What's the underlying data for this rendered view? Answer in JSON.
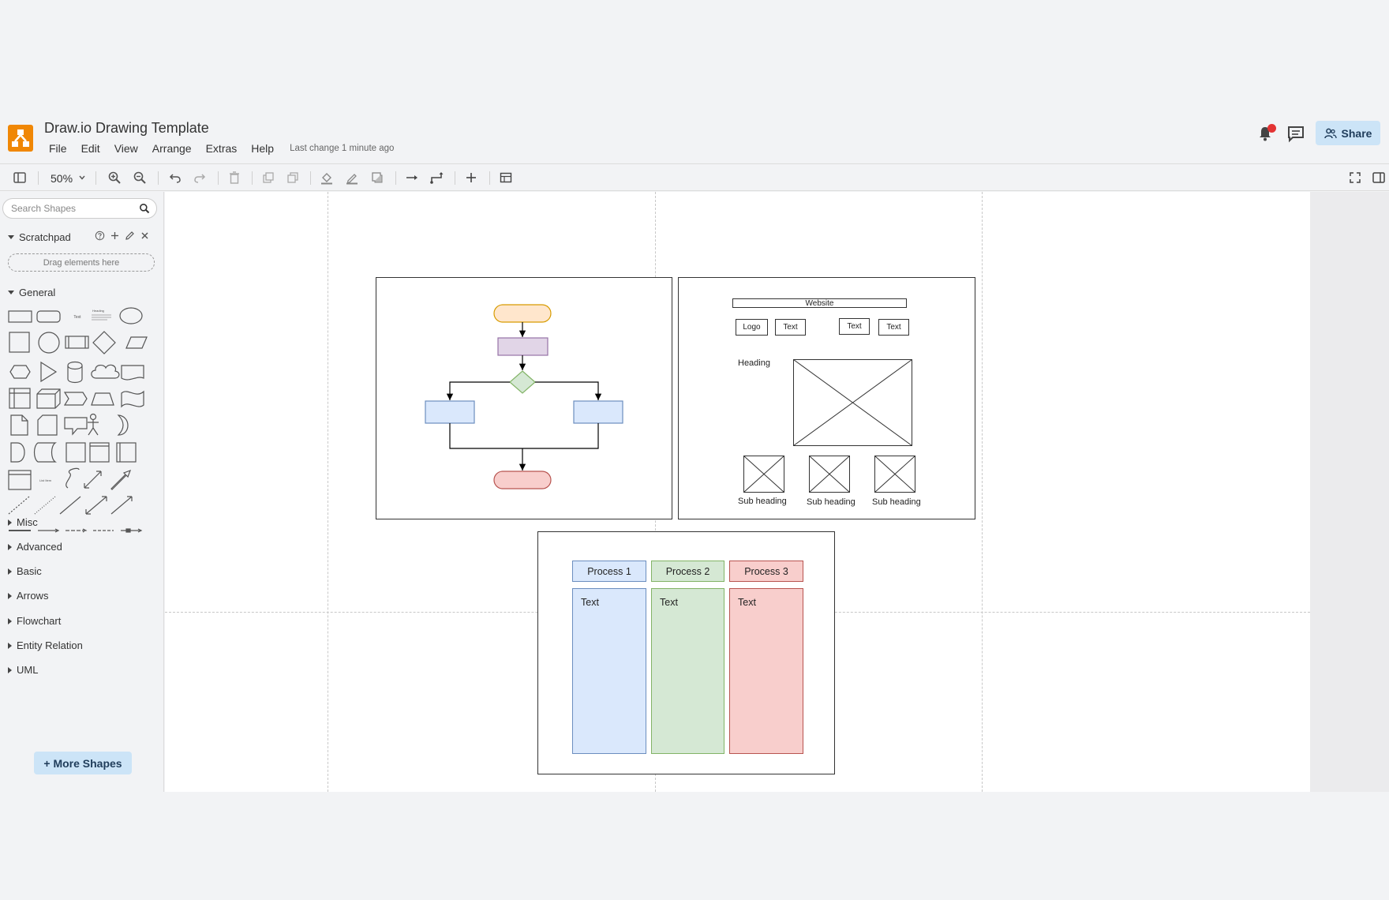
{
  "app": {
    "title": "Draw.io Drawing Template",
    "last_change": "Last change 1 minute ago",
    "brand_color": "#f08705"
  },
  "menu": {
    "items": [
      "File",
      "Edit",
      "View",
      "Arrange",
      "Extras",
      "Help"
    ]
  },
  "header": {
    "share_label": "Share",
    "notification_badge_color": "#e33333"
  },
  "toolbar": {
    "zoom": "50%"
  },
  "sidebar": {
    "search_placeholder": "Search Shapes",
    "scratchpad": {
      "label": "Scratchpad",
      "drop_hint": "Drag elements here"
    },
    "general_label": "General",
    "collapsed_sections": [
      "Misc",
      "Advanced",
      "Basic",
      "Arrows",
      "Flowchart",
      "Entity Relation",
      "UML"
    ],
    "more_shapes_label": "+ More Shapes"
  },
  "canvas": {
    "wireframe": {
      "banner": "Website",
      "nav": [
        "Logo",
        "Text",
        "Text",
        "Text"
      ],
      "heading": "Heading",
      "sub_headings": [
        "Sub heading",
        "Sub heading",
        "Sub heading"
      ]
    },
    "swimlanes": [
      {
        "title": "Process 1",
        "text": "Text",
        "head_color": "#dae8fc",
        "border_color": "#6c8ebf"
      },
      {
        "title": "Process 2",
        "text": "Text",
        "head_color": "#d5e8d4",
        "border_color": "#82b366"
      },
      {
        "title": "Process 3",
        "text": "Text",
        "head_color": "#f8cecc",
        "border_color": "#b85450"
      }
    ],
    "flowchart_colors": {
      "start": "#ffe6cc",
      "process": "#e1d5e7",
      "decision": "#d5e8d4",
      "branch": "#dae8fc",
      "end": "#f8cecc"
    }
  }
}
